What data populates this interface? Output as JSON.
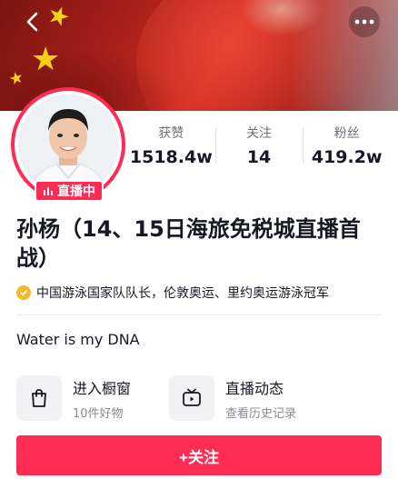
{
  "profile": {
    "name": "孙杨（14、15日海旅免税城直播首战）",
    "verification": "中国游泳国家队队长，伦敦奥运、里约奥运游泳冠军",
    "bio": "Water is my DNA",
    "live_badge": "直播中"
  },
  "stats": [
    {
      "label": "获赞",
      "value": "1518.4w"
    },
    {
      "label": "关注",
      "value": "14"
    },
    {
      "label": "粉丝",
      "value": "419.2w"
    }
  ],
  "shortcuts": [
    {
      "title": "进入橱窗",
      "subtitle": "10件好物",
      "icon": "shopping-bag-icon"
    },
    {
      "title": "直播动态",
      "subtitle": "查看历史记录",
      "icon": "tv-icon"
    }
  ],
  "follow_button": "+关注",
  "colors": {
    "accent": "#fe2c55",
    "verify": "#f5b72b",
    "flag_red": "#d12b20",
    "flag_star": "#f7d118"
  }
}
